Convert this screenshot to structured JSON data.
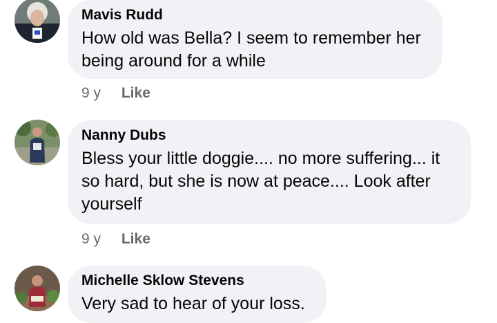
{
  "comments": [
    {
      "author": "Mavis Rudd",
      "text_lines": [
        "How old was Bella? I seem to remember her",
        "being around for a while"
      ],
      "time": "9 y",
      "like_label": "Like"
    },
    {
      "author": "Nanny Dubs",
      "text_lines": [
        "Bless your little doggie.... no more suffering... it",
        "so hard, but she is now at peace.... Look after",
        "yourself"
      ],
      "time": "9 y",
      "like_label": "Like"
    },
    {
      "author": "Michelle Sklow Stevens",
      "text_lines": [
        "Very sad to hear of your loss."
      ]
    }
  ],
  "colors": {
    "bubble_bg": "#f0f2f5",
    "meta_text": "#65676b",
    "text": "#050505"
  }
}
